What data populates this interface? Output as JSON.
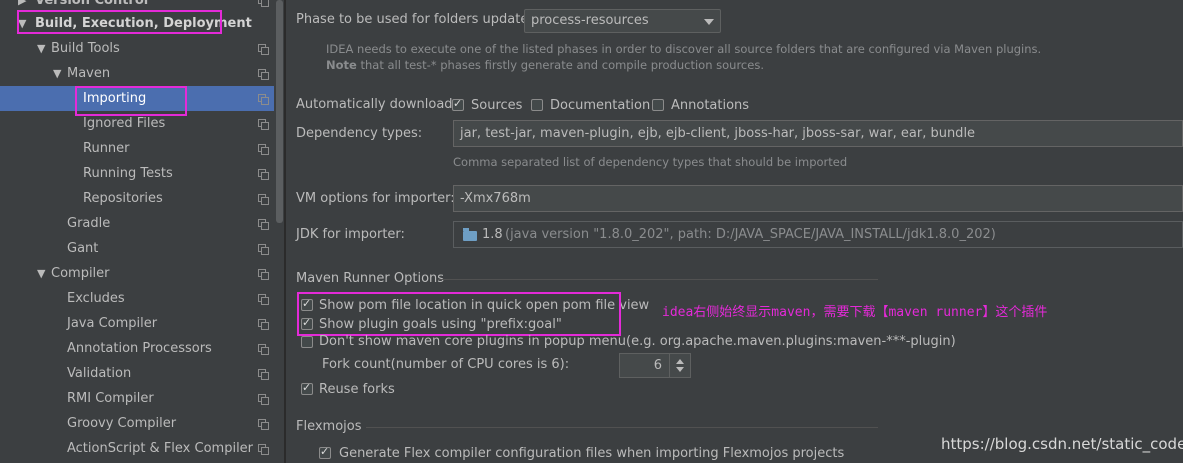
{
  "sidebar": {
    "items": [
      {
        "label": "Version Control",
        "arrow": "▶",
        "indent": 0
      },
      {
        "label": "Build, Execution, Deployment",
        "arrow": "▼",
        "indent": 0
      },
      {
        "label": "Build Tools",
        "arrow": "▼",
        "indent": 1
      },
      {
        "label": "Maven",
        "arrow": "▼",
        "indent": 2
      },
      {
        "label": "Importing",
        "arrow": "",
        "indent": 3
      },
      {
        "label": "Ignored Files",
        "arrow": "",
        "indent": 3
      },
      {
        "label": "Runner",
        "arrow": "",
        "indent": 3
      },
      {
        "label": "Running Tests",
        "arrow": "",
        "indent": 3
      },
      {
        "label": "Repositories",
        "arrow": "",
        "indent": 3
      },
      {
        "label": "Gradle",
        "arrow": "",
        "indent": 2
      },
      {
        "label": "Gant",
        "arrow": "",
        "indent": 2
      },
      {
        "label": "Compiler",
        "arrow": "▼",
        "indent": 1
      },
      {
        "label": "Excludes",
        "arrow": "",
        "indent": 2
      },
      {
        "label": "Java Compiler",
        "arrow": "",
        "indent": 2
      },
      {
        "label": "Annotation Processors",
        "arrow": "",
        "indent": 2
      },
      {
        "label": "Validation",
        "arrow": "",
        "indent": 2
      },
      {
        "label": "RMI Compiler",
        "arrow": "",
        "indent": 2
      },
      {
        "label": "Groovy Compiler",
        "arrow": "",
        "indent": 2
      },
      {
        "label": "ActionScript & Flex Compiler",
        "arrow": "",
        "indent": 2
      }
    ],
    "selected_label": "Importing"
  },
  "phase": {
    "label": "Phase to be used for folders update:",
    "value": "process-resources",
    "hint_line1": "IDEA needs to execute one of the listed phases in order to discover all source folders that are configured via Maven plugins.",
    "hint_note": "Note",
    "hint_line2": " that all test-* phases firstly generate and compile production sources."
  },
  "auto_download": {
    "label": "Automatically download:",
    "options": [
      {
        "label": "Sources",
        "checked": true
      },
      {
        "label": "Documentation",
        "checked": false
      },
      {
        "label": "Annotations",
        "checked": false
      }
    ]
  },
  "dependency_types": {
    "label": "Dependency types:",
    "value": "jar, test-jar, maven-plugin, ejb, ejb-client, jboss-har, jboss-sar, war, ear, bundle",
    "hint": "Comma separated list of dependency types that should be imported"
  },
  "vm_options": {
    "label": "VM options for importer:",
    "value": "-Xmx768m"
  },
  "jdk": {
    "label": "JDK for importer:",
    "version": "1.8",
    "detail": "(java version \"1.8.0_202\", path: D:/JAVA_SPACE/JAVA_INSTALL/jdk1.8.0_202)",
    "icon": "folder-icon"
  },
  "runner": {
    "section_title": "Maven Runner Options",
    "options": [
      {
        "label": "Show pom file location in quick open pom file view",
        "checked": true
      },
      {
        "label": "Show plugin goals using \"prefix:goal\"",
        "checked": true
      },
      {
        "label": "Don't show maven core plugins in popup menu(e.g. org.apache.maven.plugins:maven-***-plugin)",
        "checked": false
      }
    ],
    "fork_label": "Fork count(number of CPU cores is 6):",
    "fork_value": "6",
    "reuse_forks_label": "Reuse forks",
    "reuse_forks_checked": true
  },
  "flexmojos": {
    "section_title": "Flexmojos",
    "option_label": "Generate Flex compiler configuration files when importing Flexmojos projects",
    "checked": true
  },
  "annotation_text": "idea右侧始终显示maven，需要下载【maven runner】这个插件",
  "watermark": "https://blog.csdn.net/static_coder",
  "colors": {
    "highlight": "#e42ad8",
    "selection": "#4b6eaf",
    "background": "#3c3f41"
  }
}
